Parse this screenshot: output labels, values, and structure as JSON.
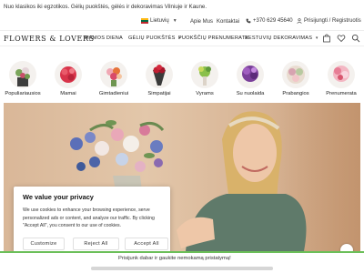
{
  "promo_text": "Nuo klasikos iki egzotikos. Gėlių puokštės, gėlės ir dekoravimas Vilniuje ir Kaune.",
  "util": {
    "language": "Lietuvių",
    "about": "Apie Mus",
    "contacts": "Kontaktai",
    "phone": "+370 629 45640",
    "login": "Prisijungti / Registruotis"
  },
  "brand": {
    "logo_text": "FLOWERS & LOVERS"
  },
  "nav": {
    "items": [
      "MAMOS DIENA",
      "GĖLIŲ PUOKŠTĖS",
      "PUOKŠČIŲ PRENUMERATA",
      "VESTUVIŲ DEKORAVIMAS"
    ],
    "icons": [
      "cart-icon",
      "heart-icon",
      "search-icon"
    ]
  },
  "categories": [
    {
      "label": "Populiariausios",
      "icon": "bouquet-mixed"
    },
    {
      "label": "Mamai",
      "icon": "bouquet-red"
    },
    {
      "label": "Gimtadieniui",
      "icon": "bouquet-pink-orange"
    },
    {
      "label": "Simpatijai",
      "icon": "bouquet-red-roses"
    },
    {
      "label": "Vyrams",
      "icon": "bouquet-green"
    },
    {
      "label": "Su nuolaida",
      "icon": "bouquet-purple"
    },
    {
      "label": "Prabangios",
      "icon": "bouquet-pastel"
    },
    {
      "label": "Prenumerata",
      "icon": "bouquet-pink"
    }
  ],
  "cookie": {
    "title": "We value your privacy",
    "body": "We use cookies to enhance your browsing experience, serve personalized ads or content, and analyze our traffic. By clicking \"Accept All\", you consent to our use of cookies.",
    "customize": "Customize",
    "reject": "Reject All",
    "accept": "Accept All"
  },
  "bottom_bar": {
    "text": "Prisijunk dabar ir gaukite nemokamą pristatymą!"
  },
  "colors": {
    "accent_green": "#6bbf59",
    "hero_bg": "#dcbd9f"
  }
}
